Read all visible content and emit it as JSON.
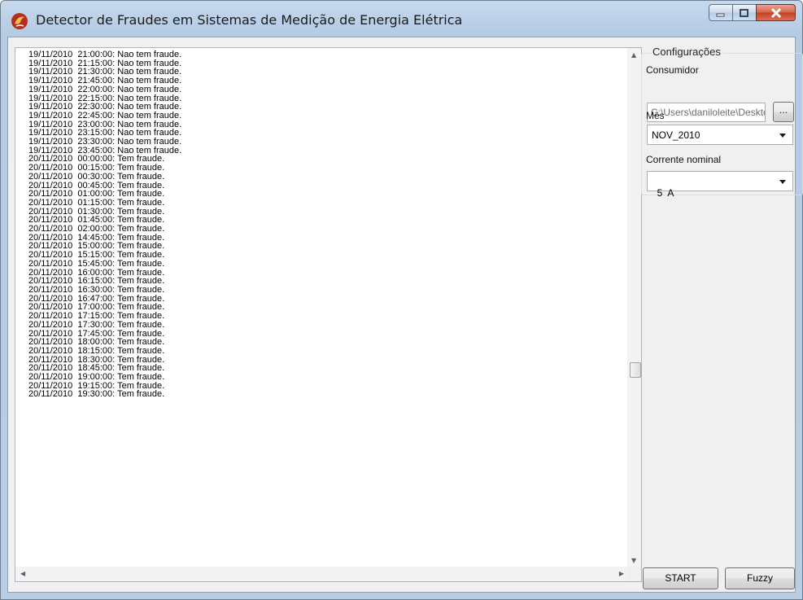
{
  "window": {
    "title": "Detector de Fraudes em Sistemas de Medição de Energia Elétrica"
  },
  "log": {
    "lines": [
      "19/11/2010  21:00:00: Nao tem fraude.",
      "19/11/2010  21:15:00: Nao tem fraude.",
      "19/11/2010  21:30:00: Nao tem fraude.",
      "19/11/2010  21:45:00: Nao tem fraude.",
      "19/11/2010  22:00:00: Nao tem fraude.",
      "19/11/2010  22:15:00: Nao tem fraude.",
      "19/11/2010  22:30:00: Nao tem fraude.",
      "19/11/2010  22:45:00: Nao tem fraude.",
      "19/11/2010  23:00:00: Nao tem fraude.",
      "19/11/2010  23:15:00: Nao tem fraude.",
      "19/11/2010  23:30:00: Nao tem fraude.",
      "19/11/2010  23:45:00: Nao tem fraude.",
      "20/11/2010  00:00:00: Tem fraude.",
      "20/11/2010  00:15:00: Tem fraude.",
      "20/11/2010  00:30:00: Tem fraude.",
      "20/11/2010  00:45:00: Tem fraude.",
      "20/11/2010  01:00:00: Tem fraude.",
      "20/11/2010  01:15:00: Tem fraude.",
      "20/11/2010  01:30:00: Tem fraude.",
      "20/11/2010  01:45:00: Tem fraude.",
      "20/11/2010  02:00:00: Tem fraude.",
      "20/11/2010  14:45:00: Tem fraude.",
      "20/11/2010  15:00:00: Tem fraude.",
      "20/11/2010  15:15:00: Tem fraude.",
      "20/11/2010  15:45:00: Tem fraude.",
      "20/11/2010  16:00:00: Tem fraude.",
      "20/11/2010  16:15:00: Tem fraude.",
      "20/11/2010  16:30:00: Tem fraude.",
      "20/11/2010  16:47:00: Tem fraude.",
      "20/11/2010  17:00:00: Tem fraude.",
      "20/11/2010  17:15:00: Tem fraude.",
      "20/11/2010  17:30:00: Tem fraude.",
      "20/11/2010  17:45:00: Tem fraude.",
      "20/11/2010  18:00:00: Tem fraude.",
      "20/11/2010  18:15:00: Tem fraude.",
      "20/11/2010  18:30:00: Tem fraude.",
      "20/11/2010  18:45:00: Tem fraude.",
      "20/11/2010  19:00:00: Tem fraude.",
      "20/11/2010  19:15:00: Tem fraude.",
      "20/11/2010  19:30:00: Tem fraude."
    ]
  },
  "config": {
    "group_label": "Configurações",
    "consumidor_label": "Consumidor",
    "consumidor_path": "C:\\Users\\daniloleite\\Desktop",
    "browse_label": "...",
    "mes_label": "Mês",
    "mes_value": "NOV_2010",
    "corrente_label": "Corrente nominal",
    "corrente_value": "5  A"
  },
  "buttons": {
    "start": "START",
    "fuzzy": "Fuzzy"
  },
  "colors": {
    "titlebar": "#c6d9ee",
    "close_button": "#c3401f"
  }
}
